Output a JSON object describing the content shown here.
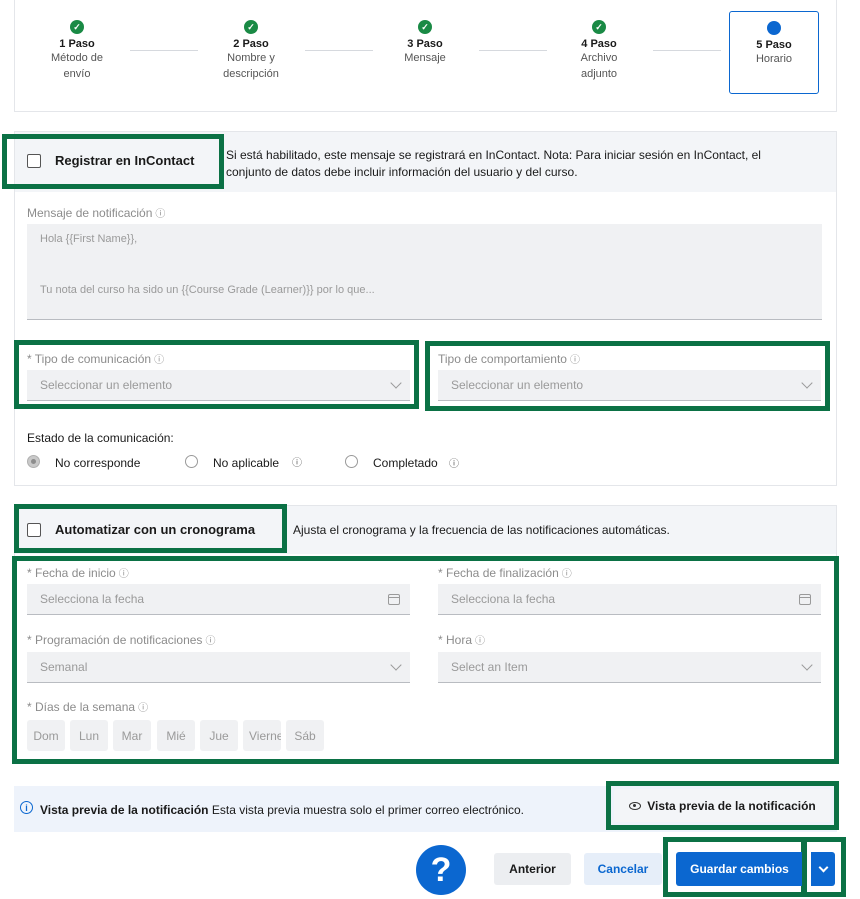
{
  "stepper": {
    "steps": [
      {
        "title": "1 Paso",
        "sub1": "Método de",
        "sub2": "envío",
        "check": "✓"
      },
      {
        "title": "2 Paso",
        "sub1": "Nombre y",
        "sub2": "descripción",
        "check": "✓"
      },
      {
        "title": "3 Paso",
        "sub1": "Mensaje",
        "sub2": "",
        "check": "✓"
      },
      {
        "title": "4 Paso",
        "sub1": "Archivo",
        "sub2": "adjunto",
        "check": "✓"
      },
      {
        "title": "5 Paso",
        "sub1": "Horario",
        "sub2": ""
      }
    ]
  },
  "incontact": {
    "label": "Registrar en InContact",
    "desc_line1": "Si está habilitado, este mensaje se registrará en InContact. Nota: Para iniciar sesión en InContact, el",
    "desc_line2": "conjunto de datos debe incluir información del usuario y del curso."
  },
  "notification": {
    "label": "Mensaje de notificación",
    "line1": "Hola {{First Name}},",
    "line2": "Tu nota del curso ha sido un {{Course Grade (Learner)}} por lo que..."
  },
  "comm_type": {
    "label": "* Tipo de comunicación",
    "placeholder": "Seleccionar un elemento"
  },
  "behavior_type": {
    "label": "Tipo de comportamiento",
    "placeholder": "Seleccionar un elemento"
  },
  "comm_status": {
    "label": "Estado de la comunicación:",
    "options": [
      "No corresponde",
      "No aplicable",
      "Completado"
    ]
  },
  "schedule": {
    "label": "Automatizar con un cronograma",
    "desc": "Ajusta el cronograma y la frecuencia de las notificaciones automáticas.",
    "start_label": "* Fecha de inicio",
    "start_placeholder": "Selecciona la fecha",
    "end_label": "* Fecha de finalización",
    "end_placeholder": "Selecciona la fecha",
    "prog_label": "* Programación de notificaciones",
    "prog_value": "Semanal",
    "hour_label": "* Hora",
    "hour_placeholder": "Select an Item",
    "days_label": "* Días de la semana",
    "days": [
      "Dom",
      "Lun",
      "Mar",
      "Mié",
      "Jue",
      "Vierne",
      "Sáb"
    ]
  },
  "preview": {
    "title": "Vista previa de la notificación",
    "desc": "Esta vista previa muestra solo el primer correo electrónico.",
    "button": "Vista previa de la notificación"
  },
  "footer": {
    "help": "?",
    "back": "Anterior",
    "cancel": "Cancelar",
    "save": "Guardar cambios"
  },
  "colors": {
    "highlight": "#0b7145",
    "primary": "#0b67d0",
    "success": "#1a8a45"
  }
}
